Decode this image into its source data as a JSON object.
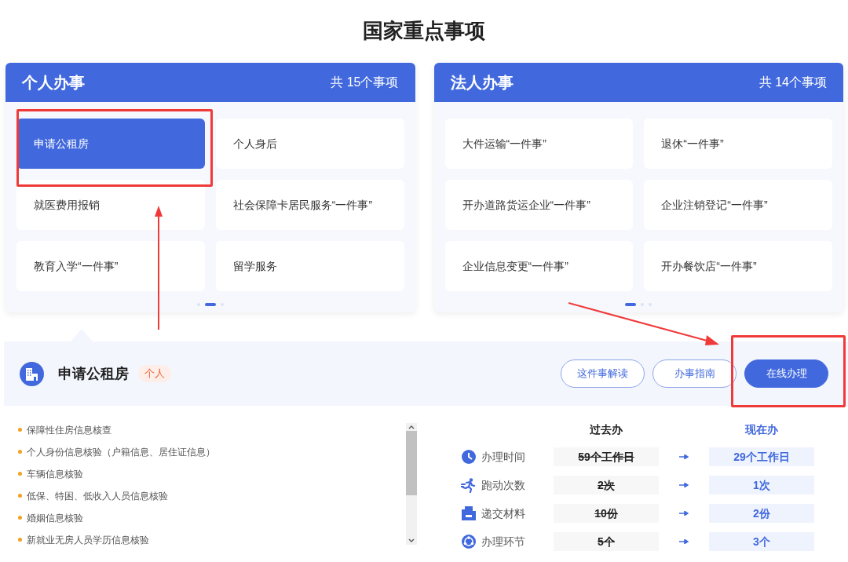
{
  "title": "国家重点事项",
  "panels": [
    {
      "heading": "个人办事",
      "count": "共 15个事项",
      "items": [
        {
          "label": "申请公租房",
          "selected": true
        },
        {
          "label": "个人身后",
          "selected": false
        },
        {
          "label": "就医费用报销",
          "selected": false
        },
        {
          "label": "社会保障卡居民服务“一件事”",
          "selected": false
        },
        {
          "label": "教育入学“一件事”",
          "selected": false
        },
        {
          "label": "留学服务",
          "selected": false
        }
      ],
      "pages": [
        {
          "selected": false
        },
        {
          "selected": true
        },
        {
          "selected": false
        }
      ]
    },
    {
      "heading": "法人办事",
      "count": "共 14个事项",
      "items": [
        {
          "label": "大件运输“一件事”",
          "selected": false
        },
        {
          "label": "退休“一件事”",
          "selected": false
        },
        {
          "label": "开办道路货运企业“一件事”",
          "selected": false
        },
        {
          "label": "企业注销登记“一件事”",
          "selected": false
        },
        {
          "label": "企业信息变更“一件事”",
          "selected": false
        },
        {
          "label": "开办餐饮店“一件事”",
          "selected": false
        }
      ],
      "pages": [
        {
          "selected": true
        },
        {
          "selected": false
        },
        {
          "selected": false
        }
      ]
    }
  ],
  "detail": {
    "title": "申请公租房",
    "tag": "个人",
    "buttons": [
      {
        "label": "这件事解读",
        "kind": "outline"
      },
      {
        "label": "办事指南",
        "kind": "outline"
      },
      {
        "label": "在线办理",
        "kind": "primary"
      }
    ],
    "checks": [
      "保障性住房信息核查",
      "个人身份信息核验（户籍信息、居住证信息）",
      "车辆信息核验",
      "低保、特困、低收入人员信息核验",
      "婚姻信息核验",
      "新就业无房人员学历信息核验"
    ],
    "compare": {
      "past_heading": "过去办",
      "now_heading": "现在办",
      "rows": [
        {
          "kind": "time",
          "label": "办理时间",
          "past": "59个工作日",
          "now": "29个工作日"
        },
        {
          "kind": "trips",
          "label": "跑动次数",
          "past": "2次",
          "now": "1次"
        },
        {
          "kind": "materials",
          "label": "递交材料",
          "past": "10份",
          "now": "2份"
        },
        {
          "kind": "steps",
          "label": "办理环节",
          "past": "5个",
          "now": "3个"
        }
      ]
    }
  }
}
